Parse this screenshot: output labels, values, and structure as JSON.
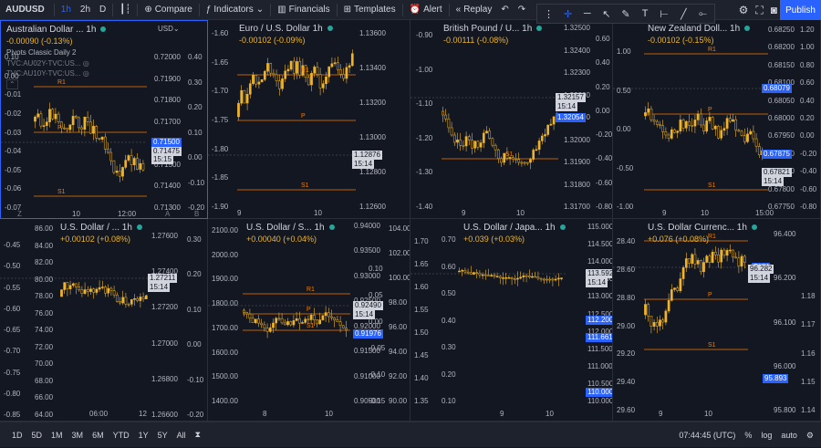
{
  "toolbar": {
    "symbol": "AUDUSD",
    "intervals": [
      "1h",
      "2h",
      "D"
    ],
    "compare": "Compare",
    "indicators": "Indicators",
    "financials": "Financials",
    "templates": "Templates",
    "alert": "Alert",
    "replay": "Replay",
    "publish": "Publish"
  },
  "bottombar": {
    "ranges": [
      "1D",
      "5D",
      "1M",
      "3M",
      "6M",
      "YTD",
      "1Y",
      "5Y",
      "All"
    ],
    "time": "07:44:45 (UTC)",
    "pct": "%",
    "log": "log",
    "auto": "auto"
  },
  "colors": {
    "candle": "#f0b428",
    "accent": "#2962ff",
    "level": "#f57c00",
    "bg": "#131722"
  },
  "panels": [
    {
      "title": "Australian Dollar ... 1h",
      "change": "-0.00090 (-0.13%)",
      "extra": [
        "Pivots Classic Daily 2",
        "TVC:AU02Y-TVC:US...",
        "TVC:AU10Y-TVC:US..."
      ],
      "left_axis": [
        "0.10",
        "0.00",
        "-0.01",
        "-0.02",
        "-0.03",
        "-0.04",
        "-0.05",
        "-0.06",
        "-0.07"
      ],
      "mid_axis": [
        "0.72000",
        "0.71900",
        "0.71800",
        "0.71700",
        "0.71600",
        "0.71500",
        "0.71400",
        "0.71300"
      ],
      "right_axis": [
        "0.40",
        "0.30",
        "0.20",
        "0.10",
        "0.00",
        "-0.10",
        "-0.20"
      ],
      "axis_unit": "USD",
      "levels": [
        "R1",
        "P",
        "S1"
      ],
      "tags": [
        "0.71500",
        "0.71475",
        "15:15"
      ],
      "xticks": [
        "10",
        "12:00"
      ],
      "corner": [
        "Z",
        "A",
        "B"
      ]
    },
    {
      "title": "Euro / U.S. Dollar 1h",
      "change": "-0.00102 (-0.09%)",
      "left_axis": [
        "-1.60",
        "-1.65",
        "-1.70",
        "-1.75",
        "-1.80",
        "-1.85",
        "-1.90"
      ],
      "right_axis": [
        "1.13600",
        "1.13400",
        "1.13200",
        "1.13000",
        "1.12800",
        "1.12600"
      ],
      "levels": [
        "R1",
        "P",
        "S1"
      ],
      "tags": [
        "1.12876",
        "15:14"
      ],
      "xticks": [
        "9",
        "10"
      ]
    },
    {
      "title": "British Pound / U... 1h",
      "change": "-0.00111 (-0.08%)",
      "left_axis": [
        "-0.90",
        "-1.00",
        "-1.10",
        "-1.20",
        "-1.30",
        "-1.40"
      ],
      "right_axis": [
        "1.32500",
        "1.32400",
        "1.32300",
        "1.32200",
        "1.32100",
        "1.32000",
        "1.31900",
        "1.31800",
        "1.31700"
      ],
      "mid_axis": [
        "0.60",
        "0.40",
        "0.20",
        "0.00",
        "-0.20",
        "-0.40",
        "-0.60",
        "-0.80"
      ],
      "levels": [
        "S1"
      ],
      "tags": [
        "1.32157",
        "15:14",
        "1.32054"
      ],
      "xticks": [
        "9",
        "10"
      ]
    },
    {
      "title": "New Zealand Doll... 1h",
      "change": "-0.00102 (-0.15%)",
      "left_axis": [
        "1.00",
        "0.50",
        "0.00",
        "-0.50",
        "-1.00"
      ],
      "right_axis": [
        "0.68250",
        "0.68200",
        "0.68150",
        "0.68100",
        "0.68050",
        "0.68000",
        "0.67950",
        "0.67900",
        "0.67850",
        "0.67800",
        "0.67750"
      ],
      "far_axis": [
        "1.20",
        "1.00",
        "0.80",
        "0.60",
        "0.40",
        "0.20",
        "0.00",
        "-0.20",
        "-0.40",
        "-0.60",
        "-0.80"
      ],
      "levels": [
        "R1",
        "P",
        "S1"
      ],
      "tags": [
        "0.68079",
        "0.67875",
        "0.67821",
        "15:14"
      ],
      "xticks": [
        "9",
        "10",
        "15:00"
      ]
    },
    {
      "title": "U.S. Dollar / ... 1h",
      "change": "+0.00102 (+0.08%)",
      "left_axis": [
        "-0.45",
        "-0.50",
        "-0.55",
        "-0.60",
        "-0.65",
        "-0.70",
        "-0.75",
        "-0.80",
        "-0.85"
      ],
      "outer_axis": [
        "86.00",
        "84.00",
        "82.00",
        "80.00",
        "78.00",
        "76.00",
        "74.00",
        "72.00",
        "70.00",
        "68.00",
        "66.00",
        "64.00"
      ],
      "right_axis": [
        "1.27600",
        "1.27400",
        "1.27200",
        "1.27000",
        "1.26800",
        "1.26600"
      ],
      "mid_axis": [
        "0.30",
        "0.20",
        "0.10",
        "0.00",
        "-0.10",
        "-0.20"
      ],
      "tags": [
        "1.27211",
        "15:14"
      ],
      "xticks": [
        "06:00",
        "12"
      ]
    },
    {
      "title": "U.S. Dollar / S... 1h",
      "change": "+0.00040 (+0.04%)",
      "left_axis": [
        "2100.00",
        "2000.00",
        "1900.00",
        "1800.00",
        "1700.00",
        "1600.00",
        "1500.00",
        "1400.00"
      ],
      "mid_axis": [
        "0.10",
        "0.05",
        "0.00",
        "-0.05",
        "-0.10",
        "-0.15"
      ],
      "right_axis": [
        "0.94000",
        "0.93500",
        "0.93000",
        "0.92500",
        "0.92000",
        "0.91500",
        "0.91000",
        "0.90500"
      ],
      "far_axis": [
        "104.00",
        "102.00",
        "100.00",
        "98.00",
        "96.00",
        "94.00",
        "92.00",
        "90.00"
      ],
      "levels": [
        "R1",
        "P",
        "S1"
      ],
      "tags": [
        "0.92490",
        "15:14",
        "0.91976"
      ],
      "xticks": [
        "8",
        "10"
      ]
    },
    {
      "title": "U.S. Dollar / Japa... 1h",
      "change": "+0.039 (+0.03%)",
      "left_axis": [
        "1.70",
        "1.65",
        "1.60",
        "1.55",
        "1.50",
        "1.45",
        "1.40",
        "1.35"
      ],
      "mid_axis": [
        "0.70",
        "0.60",
        "0.50",
        "0.40",
        "0.30",
        "0.20",
        "0.10"
      ],
      "right_axis": [
        "115.000",
        "114.500",
        "114.000",
        "113.500",
        "113.000",
        "112.500",
        "112.000",
        "111.500",
        "111.000",
        "110.500",
        "110.000"
      ],
      "tags": [
        "113.592",
        "15:14",
        "112.200",
        "111.661",
        "110.000"
      ],
      "xticks": [
        "9",
        "10"
      ]
    },
    {
      "title": "U.S. Dollar Currenc... 1h",
      "change": "+0.076 (+0.08%)",
      "left_axis": [
        "28.40",
        "28.60",
        "28.80",
        "29.00",
        "29.20",
        "29.40",
        "29.60"
      ],
      "right_axis": [
        "96.400",
        "96.200",
        "96.100",
        "96.000",
        "95.800"
      ],
      "far_axis": [
        "1.18",
        "1.17",
        "1.16",
        "1.15",
        "1.14"
      ],
      "levels": [
        "R1",
        "P",
        "S1"
      ],
      "tags": [
        "DXY",
        "96.282",
        "15:14",
        "95.893"
      ],
      "xticks": [
        "9",
        "10"
      ]
    }
  ]
}
